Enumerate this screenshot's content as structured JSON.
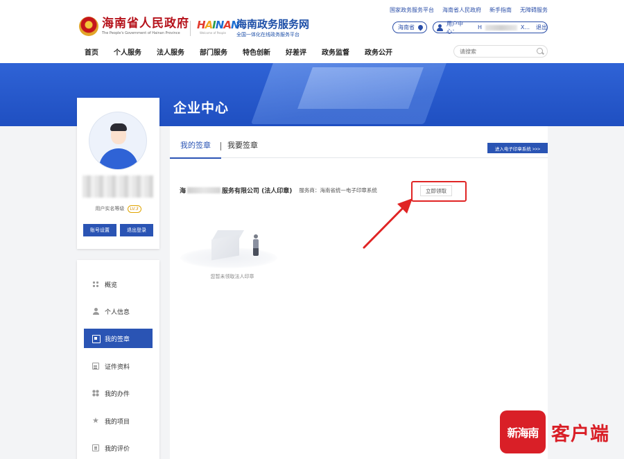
{
  "header": {
    "top_links": [
      "国家政务服务平台",
      "海南省人民政府",
      "新手指南",
      "无障碍服务"
    ],
    "gov_title": "海南省人民政府",
    "gov_subtitle": "The People's Government of Hainan Province",
    "hainan_logo_text": "HAINAN",
    "hainan_logo_sub": "Welcome of People",
    "service_title": "海南政务服务网",
    "service_subtitle": "全国一体化在线政务服务平台",
    "region": "海南省",
    "user_center_label": "用户中心：",
    "user_name_prefix": "H",
    "user_name_suffix": "X...",
    "logout": "退出",
    "nav": [
      "首页",
      "个人服务",
      "法人服务",
      "部门服务",
      "特色创新",
      "好差评",
      "政务监督",
      "政务公开"
    ],
    "search_placeholder": "请搜索"
  },
  "banner": {
    "title": "企业中心"
  },
  "profile": {
    "level_label": "用户实名等级",
    "level": "LV.3",
    "account_settings": "账号设置",
    "exit_login": "退出登录"
  },
  "menu": {
    "items": [
      {
        "label": "概览",
        "icon": "grid-icon"
      },
      {
        "label": "个人信息",
        "icon": "user-icon"
      },
      {
        "label": "我的签章",
        "icon": "stamp-icon",
        "active": true
      },
      {
        "label": "证件资料",
        "icon": "document-icon"
      },
      {
        "label": "我的办件",
        "icon": "apps-icon"
      },
      {
        "label": "我的项目",
        "icon": "star-icon"
      },
      {
        "label": "我的评价",
        "icon": "note-icon"
      }
    ]
  },
  "main": {
    "tabs": [
      "我的签章",
      "我要签章"
    ],
    "enter_system": "进入电子印章系统 >>>",
    "seal": {
      "prefix": "海",
      "name": "服务有限公司 (法人印章)",
      "provider": "服务商：海南省统一电子印章系统",
      "claim_button": "立即领取"
    },
    "empty_text": "您暂未领取法人印章"
  },
  "watermark": {
    "logo_text": "新海南",
    "text": "客户端"
  },
  "colors": {
    "brand_blue": "#2a54b4",
    "banner_blue": "#2f63d6",
    "gov_red": "#b5111a",
    "highlight_red": "#e02424"
  }
}
